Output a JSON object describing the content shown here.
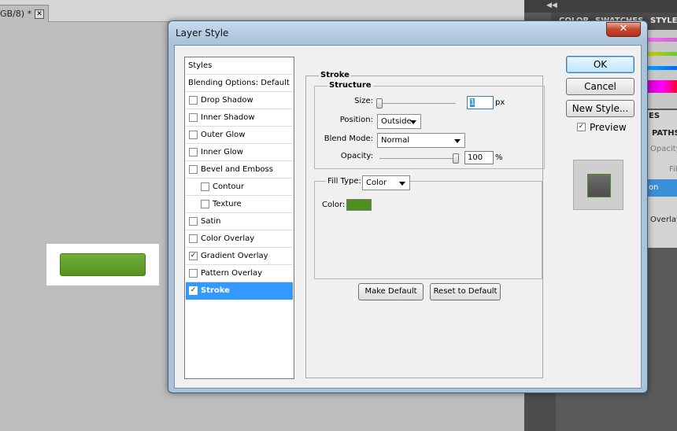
{
  "app": {
    "document_tab": "GB/8) *",
    "document_tab_close": "✕",
    "dock_collapse": "◀◀",
    "panel_tabs": [
      "COLOR",
      "SWATCHES",
      "STYLES"
    ],
    "side_tabs": [
      "ES",
      "PATHS"
    ],
    "side_labels": [
      "Opacity",
      "Fill",
      "on",
      "Overlay"
    ]
  },
  "dialog": {
    "title": "Layer Style",
    "close": "✕",
    "style_list": [
      {
        "label": "Styles",
        "checkbox": false,
        "checked": false,
        "indent": false,
        "selected": false
      },
      {
        "label": "Blending Options: Default",
        "checkbox": false,
        "checked": false,
        "indent": false,
        "selected": false
      },
      {
        "label": "Drop Shadow",
        "checkbox": true,
        "checked": false,
        "indent": false,
        "selected": false
      },
      {
        "label": "Inner Shadow",
        "checkbox": true,
        "checked": false,
        "indent": false,
        "selected": false
      },
      {
        "label": "Outer Glow",
        "checkbox": true,
        "checked": false,
        "indent": false,
        "selected": false
      },
      {
        "label": "Inner Glow",
        "checkbox": true,
        "checked": false,
        "indent": false,
        "selected": false
      },
      {
        "label": "Bevel and Emboss",
        "checkbox": true,
        "checked": false,
        "indent": false,
        "selected": false
      },
      {
        "label": "Contour",
        "checkbox": true,
        "checked": false,
        "indent": true,
        "selected": false
      },
      {
        "label": "Texture",
        "checkbox": true,
        "checked": false,
        "indent": true,
        "selected": false
      },
      {
        "label": "Satin",
        "checkbox": true,
        "checked": false,
        "indent": false,
        "selected": false
      },
      {
        "label": "Color Overlay",
        "checkbox": true,
        "checked": false,
        "indent": false,
        "selected": false
      },
      {
        "label": "Gradient Overlay",
        "checkbox": true,
        "checked": true,
        "indent": false,
        "selected": false
      },
      {
        "label": "Pattern Overlay",
        "checkbox": true,
        "checked": false,
        "indent": false,
        "selected": false
      },
      {
        "label": "Stroke",
        "checkbox": true,
        "checked": true,
        "indent": false,
        "selected": true
      }
    ],
    "stroke": {
      "title": "Stroke",
      "structure_title": "Structure",
      "size_label": "Size:",
      "size_value": "1",
      "size_unit": "px",
      "size_fraction": 0.0,
      "position_label": "Position:",
      "position_value": "Outside",
      "blend_label": "Blend Mode:",
      "blend_value": "Normal",
      "opacity_label": "Opacity:",
      "opacity_value": "100",
      "opacity_unit": "%",
      "opacity_fraction": 1.0,
      "fill_type_label": "Fill Type:",
      "fill_type_value": "Color",
      "color_label": "Color:",
      "color_value": "#4f8f1e",
      "make_default": "Make Default",
      "reset_default": "Reset to Default"
    },
    "buttons": {
      "ok": "OK",
      "cancel": "Cancel",
      "new_style": "New Style...",
      "preview_label": "Preview",
      "preview_checked": true
    }
  },
  "colors": {
    "accent": "#3399ff",
    "button_green": "#6aa533",
    "stroke_green": "#4f8f1e"
  }
}
